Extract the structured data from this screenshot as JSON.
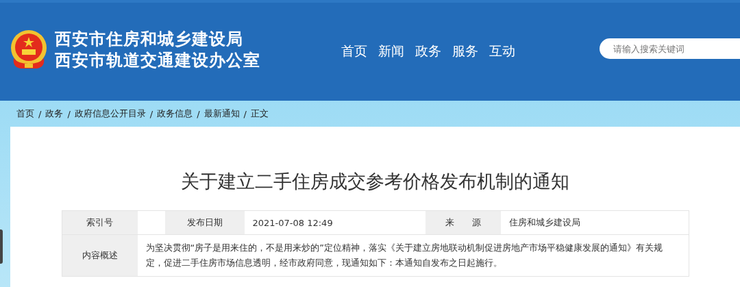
{
  "header": {
    "title_lines": [
      "西安市住房和城乡建设局",
      "西安市轨道交通建设办公室"
    ],
    "nav": [
      {
        "label": "首页",
        "selected": false
      },
      {
        "label": "新闻",
        "selected": false
      },
      {
        "label": "政务",
        "selected": false
      },
      {
        "label": "服务",
        "selected": false
      },
      {
        "label": "互动",
        "selected": false
      }
    ],
    "search": {
      "placeholder": "请输入搜索关键词"
    }
  },
  "breadcrumb": {
    "separator": "/",
    "items": [
      "首页",
      "政务",
      "政府信息公开目录",
      "政务信息",
      "最新通知",
      "正文"
    ]
  },
  "article": {
    "title": "关于建立二手住房成交参考价格发布机制的通知",
    "meta": [
      {
        "label": "索引号"
      },
      {
        "label": "发布日期",
        "value": "2021-07-08 12:49"
      },
      {
        "label": "来　　源",
        "value": "住房和城乡建设局"
      }
    ],
    "summary": {
      "label": "内容概述",
      "text": "为坚决贯彻“房子是用来住的，不是用来炒的”定位精神，落实《关于建立房地联动机制促进房地产市场平稳健康发展的通知》有关规定，促进二手住房市场信息透明，经市政府同意，现通知如下：本通知自发布之日起施行。"
    }
  }
}
